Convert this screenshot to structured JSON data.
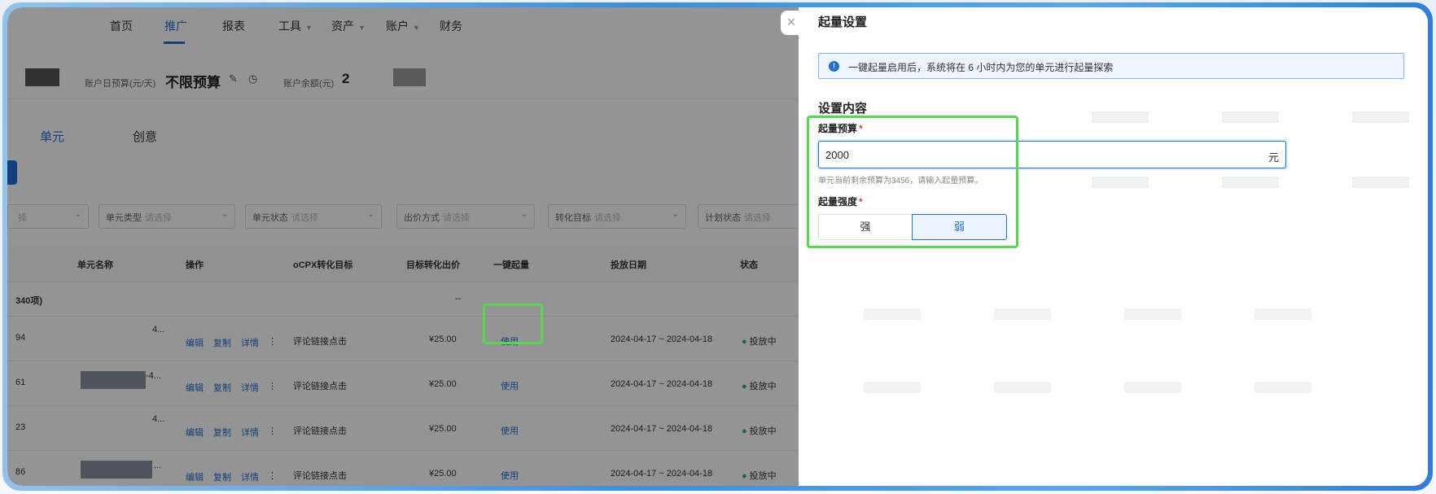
{
  "topnav": {
    "items": [
      "首页",
      "推广",
      "报表",
      "工具",
      "资产",
      "账户",
      "财务"
    ],
    "active": "推广"
  },
  "account": {
    "daily_budget_label": "账户日预算(元/天)",
    "daily_budget_value": "不限预算",
    "balance_label": "账户余额(元)",
    "balance_value": "2"
  },
  "subtabs": [
    "单元",
    "创意"
  ],
  "filters": [
    {
      "label": "",
      "placeholder": "择"
    },
    {
      "label": "单元类型",
      "placeholder": "请选择"
    },
    {
      "label": "单元状态",
      "placeholder": "请选择"
    },
    {
      "label": "出价方式",
      "placeholder": "请选择"
    },
    {
      "label": "转化目标",
      "placeholder": "请选择"
    },
    {
      "label": "计划状态",
      "placeholder": "请选择"
    }
  ],
  "table": {
    "headers": [
      "单元名称",
      "操作",
      "oCPX转化目标",
      "目标转化出价",
      "一键起量",
      "投放日期",
      "状态"
    ],
    "summary": {
      "count": "340项)",
      "bid": "--"
    },
    "rows": [
      {
        "id": "94",
        "name_tail": "4...",
        "actions": [
          "编辑",
          "复制",
          "详情"
        ],
        "goal": "评论链接点击",
        "bid": "¥25.00",
        "boost": "使用",
        "dates": "2024-04-17 ~ 2024-04-18",
        "status": "投放中"
      },
      {
        "id": "61",
        "name_tail": "-4...",
        "actions": [
          "编辑",
          "复制",
          "详情"
        ],
        "goal": "评论链接点击",
        "bid": "¥25.00",
        "boost": "使用",
        "dates": "2024-04-17 ~ 2024-04-18",
        "status": "投放中"
      },
      {
        "id": "23",
        "name_tail": "4...",
        "actions": [
          "编辑",
          "复制",
          "详情"
        ],
        "goal": "评论链接点击",
        "bid": "¥25.00",
        "boost": "使用",
        "dates": "2024-04-17 ~ 2024-04-18",
        "status": "投放中"
      },
      {
        "id": "86",
        "name_tail": "...",
        "actions": [
          "编辑",
          "复制",
          "详情"
        ],
        "goal": "评论链接点击",
        "bid": "¥25.00",
        "boost": "使用",
        "dates": "2024-04-17 ~ 2024-04-18",
        "status": "投放中"
      }
    ]
  },
  "drawer": {
    "title": "起量设置",
    "close": "×",
    "info": "一键起量启用后，系统将在 6 小时内为您的单元进行起量探索",
    "section_title": "设置内容",
    "budget_label": "起量预算",
    "budget_value": "2000",
    "budget_unit": "元",
    "budget_hint": "单元当前剩余预算为3456，请输入起量预算。",
    "strength_label": "起量强度",
    "strength_options": [
      "强",
      "弱"
    ],
    "strength_selected": "弱"
  },
  "colors": {
    "accent": "#1f6fd6",
    "highlight": "#52d94e",
    "status": "#2db35d"
  }
}
